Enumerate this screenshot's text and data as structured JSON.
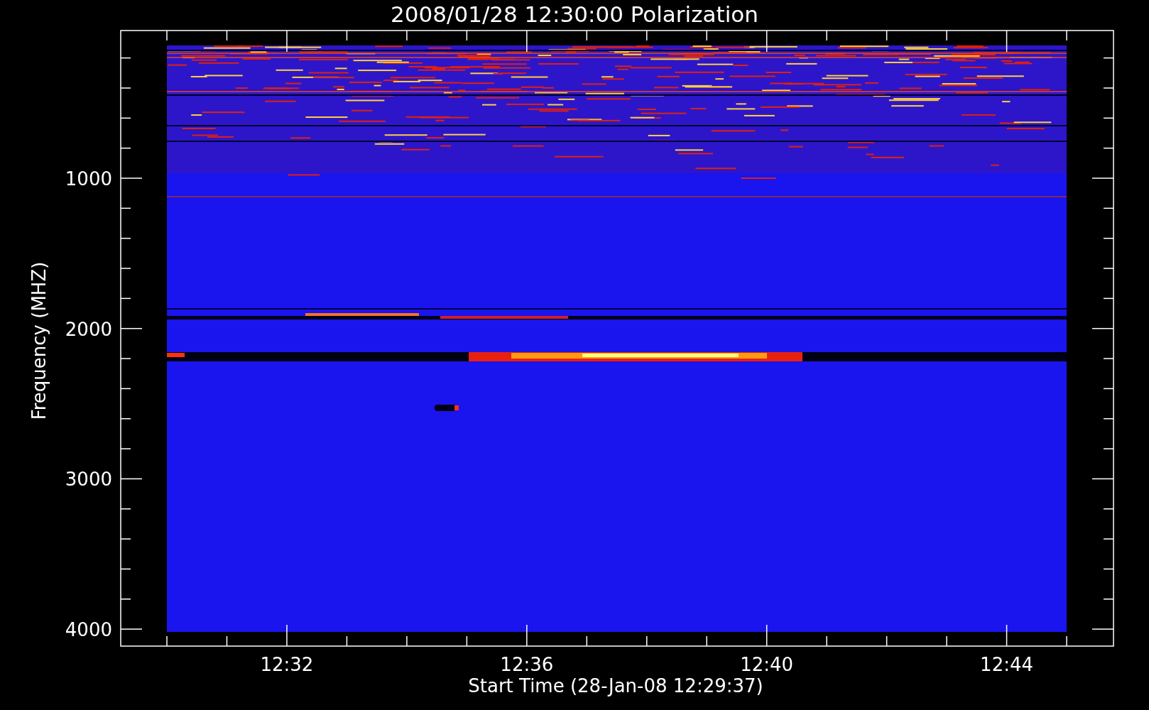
{
  "title": "2008/01/28 12:30:00 Polarization",
  "y_axis": {
    "label": "Frequency (MHZ)",
    "ticks": [
      "1000",
      "2000",
      "3000",
      "4000"
    ]
  },
  "x_axis": {
    "label": "Start Time (28-Jan-08 12:29:37)",
    "ticks": [
      "12:32",
      "12:36",
      "12:40",
      "12:44"
    ]
  }
}
